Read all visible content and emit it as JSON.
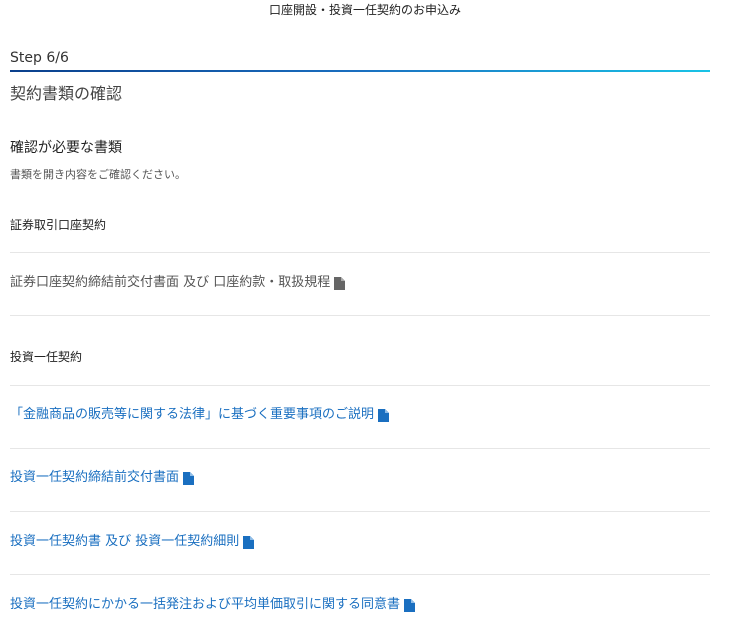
{
  "header": {
    "title": "口座開設・投資一任契約のお申込み"
  },
  "progress": {
    "step_label": "Step 6/6",
    "current": 6,
    "total": 6
  },
  "main": {
    "section_title": "契約書類の確認",
    "docs_heading": "確認が必要な書類",
    "docs_subtext": "書類を開き内容をご確認ください。",
    "groups": [
      {
        "label": "証券取引口座契約",
        "documents": [
          {
            "label": "証券口座契約締結前交付書面 及び 口座約款・取扱規程",
            "icon": "document-icon",
            "color": "#555555"
          }
        ]
      },
      {
        "label": "投資一任契約",
        "documents": [
          {
            "label": "「金融商品の販売等に関する法律」に基づく重要事項のご説明",
            "icon": "document-icon",
            "color": "#1a6fc0"
          },
          {
            "label": "投資一任契約締結前交付書面",
            "icon": "document-icon",
            "color": "#1a6fc0"
          },
          {
            "label": "投資一任契約書 及び 投資一任契約細則",
            "icon": "document-icon",
            "color": "#1a6fc0"
          },
          {
            "label": "投資一任契約にかかる一括発注および平均単価取引に関する同意書",
            "icon": "document-icon",
            "color": "#1a6fc0"
          }
        ]
      }
    ]
  },
  "colors": {
    "link": "#1a6fc0",
    "progress_start": "#0a3f8c",
    "progress_end": "#19c3e6",
    "divider": "#e6e6e6"
  }
}
